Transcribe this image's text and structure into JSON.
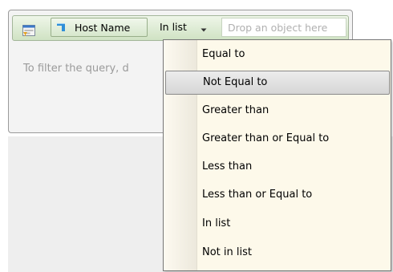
{
  "filter_bar": {
    "object": {
      "label": "Host Name",
      "icon": "dimension-object-icon"
    },
    "operator": {
      "selected": "In list",
      "icon": "chevron-down-icon"
    },
    "drop_zone": {
      "placeholder": "Drop an object here"
    },
    "filter_icon": "query-filter-icon"
  },
  "panel": {
    "hint": "To filter the query, d"
  },
  "operator_menu": {
    "highlighted_index": 1,
    "items": [
      {
        "label": "Equal to"
      },
      {
        "label": "Not Equal to"
      },
      {
        "label": "Greater than"
      },
      {
        "label": "Greater than or Equal to"
      },
      {
        "label": "Less than"
      },
      {
        "label": "Less than or Equal to"
      },
      {
        "label": "In list"
      },
      {
        "label": "Not in list"
      }
    ]
  },
  "colors": {
    "filter_bar_green": "#cfe2c3",
    "menu_background": "#fdf9ea",
    "object_icon_blue": "#2f8fd8"
  }
}
